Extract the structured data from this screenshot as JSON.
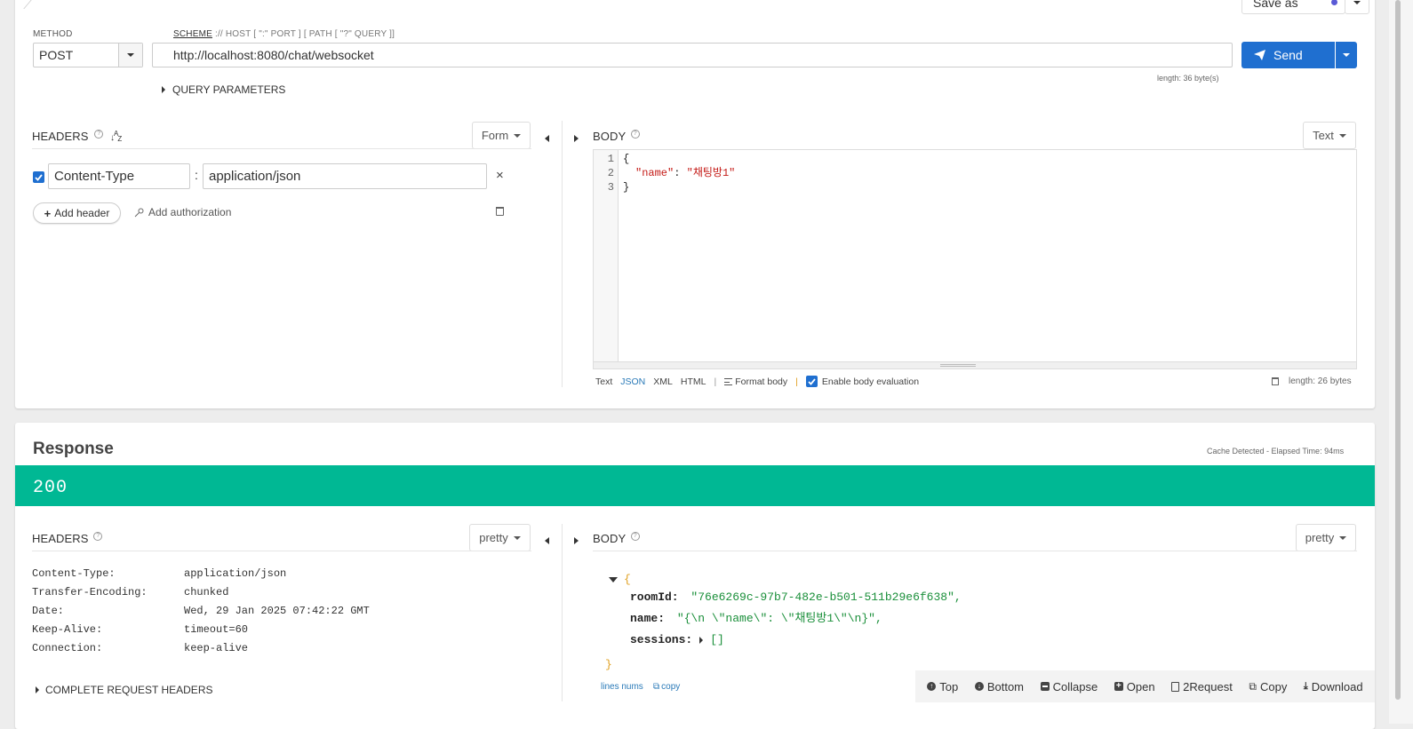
{
  "request": {
    "save_as_label": "Save as",
    "method_label": "METHOD",
    "method_value": "POST",
    "url_label_scheme": "SCHEME",
    "url_label_rest": " :// HOST [ \":\" PORT ] [ PATH [ \"?\" QUERY ]]",
    "url_value": "http://localhost:8080/chat/websocket",
    "url_length": "length: 36 byte(s)",
    "send_label": "Send",
    "query_params_label": "QUERY PARAMETERS",
    "headers_title": "HEADERS",
    "form_label": "Form",
    "header_name": "Content-Type",
    "header_value": "application/json",
    "header_separator": ":",
    "add_header_label": "Add header",
    "add_auth_label": "Add authorization",
    "body_title": "BODY",
    "body_type_label": "Text",
    "code_lines": [
      "1",
      "2",
      "3"
    ],
    "code_line1": "{",
    "code_key": "\"name\"",
    "code_colon": ": ",
    "code_value": "\"채팅방1\"",
    "code_line3": "}",
    "format_text": "Text",
    "format_json": "JSON",
    "format_xml": "XML",
    "format_html": "HTML",
    "format_sep": "|",
    "format_body_label": "Format body",
    "enable_eval_label": "Enable body evaluation",
    "body_length": "length: 26 bytes"
  },
  "response": {
    "title": "Response",
    "cache_info": "Cache Detected - Elapsed Time: 94ms",
    "status_code": "200",
    "status_color": "#00b894",
    "headers_title": "HEADERS",
    "headers_pretty_label": "pretty",
    "headers": [
      {
        "name": "Content-Type:",
        "value": "application/json"
      },
      {
        "name": "Transfer-Encoding:",
        "value": "chunked"
      },
      {
        "name": "Date:",
        "value": "Wed, 29 Jan 2025 07:42:22 GMT"
      },
      {
        "name": "Keep-Alive:",
        "value": "timeout=60"
      },
      {
        "name": "Connection:",
        "value": "keep-alive"
      }
    ],
    "complete_headers_label": "COMPLETE REQUEST HEADERS",
    "body_title": "BODY",
    "body_pretty_label": "pretty",
    "json_open": "{",
    "json_close": "}",
    "room_id_key": "roomId:",
    "room_id_value": "\"76e6269c-97b7-482e-b501-511b29e6f638\",",
    "name_key": "name:",
    "name_value": "\"{\\n  \\\"name\\\": \\\"채팅방1\\\"\\n}\",",
    "sessions_key": "sessions:",
    "sessions_value": "[]",
    "lines_nums_label": "lines nums",
    "copy_link_label": "copy",
    "toolbar": {
      "top": "Top",
      "bottom": "Bottom",
      "collapse": "Collapse",
      "open": "Open",
      "to_request": "2Request",
      "copy": "Copy",
      "download": "Download"
    }
  },
  "colors": {
    "primary": "#1f6fd0",
    "json_string": "#1a8f3a",
    "code_string": "#c41a16"
  }
}
